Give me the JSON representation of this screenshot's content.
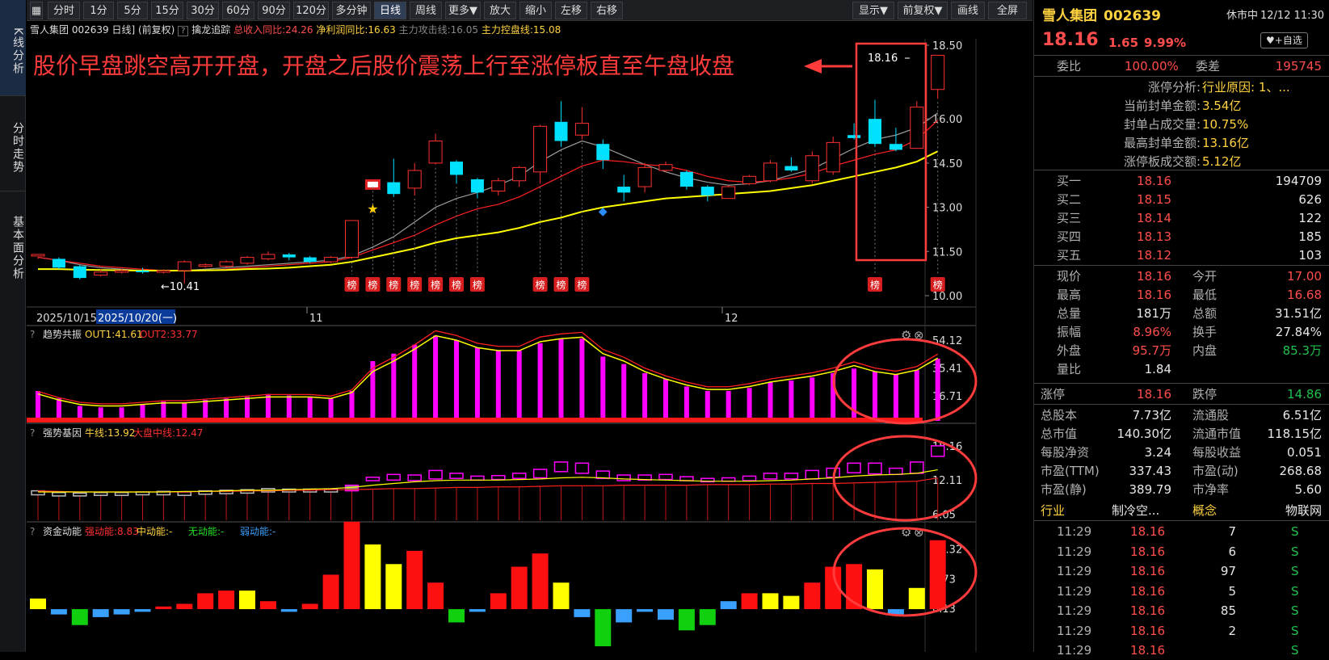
{
  "left_tabs": [
    "K线分析",
    "分时走势",
    "基本面分析"
  ],
  "toolbar": {
    "buttons": [
      "分时",
      "1分",
      "5分",
      "15分",
      "30分",
      "60分",
      "90分",
      "120分",
      "多分钟",
      "日线",
      "周线",
      "更多▼",
      "放大",
      "缩小",
      "左移",
      "右移"
    ],
    "right_buttons": [
      "显示▼",
      "前复权▼",
      "画线",
      "全屏"
    ]
  },
  "chart_header": {
    "symbol": "雪人集团 002639 日线]",
    "adj": "(前复权)",
    "q": "?",
    "indicator": "擒龙追踪",
    "rev": "总收入同比:24.26",
    "profit": "净利润同比:16.63",
    "attack": "主力攻击线:16.05",
    "control": "主力控盘线:15.08"
  },
  "annotation": {
    "text": "股价早盘跳空高开开盘，开盘之后股价震荡上行至涨停板直至午盘收盘",
    "price_label": "18.16"
  },
  "main_axis": [
    "18.50",
    "16.00",
    "14.50",
    "13.00",
    "11.50",
    "10.00"
  ],
  "low_label": "←10.41",
  "bang_label": "榜",
  "dates": {
    "d1": "2025/10/15",
    "d2": "2025/10/20(一)",
    "m11": "11",
    "m12": "12"
  },
  "sub1": {
    "q": "?",
    "name": "趋势共振",
    "out1": "OUT1:41.61",
    "out2": "OUT2:33.77",
    "axis": [
      "54.12",
      "35.41",
      "16.71"
    ]
  },
  "sub2": {
    "q": "?",
    "name": "强势基因",
    "bull": "牛线:13.92",
    "market": "大盘中线:12.47",
    "axis": [
      "18.16",
      "12.11",
      "6.05"
    ]
  },
  "sub3": {
    "q": "?",
    "name": "资金动能",
    "strong": "强动能:8.83",
    "mid": "中动能:-",
    "none": "无动能:-",
    "weak": "弱动能:-",
    "axis": [
      "11.32",
      "5.73",
      "0.13"
    ]
  },
  "chart_data": {
    "type": "candlestick",
    "candles": [
      [
        11.35,
        11.4,
        11.3,
        11.25
      ],
      [
        11.25,
        10.95,
        11.3,
        10.9
      ],
      [
        11.0,
        10.6,
        11.05,
        10.55
      ],
      [
        10.7,
        10.8,
        10.9,
        10.65
      ],
      [
        10.8,
        10.85,
        10.9,
        10.75
      ],
      [
        10.85,
        10.8,
        10.95,
        10.75
      ],
      [
        10.8,
        10.85,
        10.9,
        10.75
      ],
      [
        10.85,
        11.15,
        11.2,
        10.41
      ],
      [
        11.0,
        11.05,
        11.1,
        10.95
      ],
      [
        11.0,
        11.15,
        11.2,
        10.95
      ],
      [
        11.1,
        11.3,
        11.35,
        11.05
      ],
      [
        11.25,
        11.4,
        11.5,
        11.2
      ],
      [
        11.4,
        11.3,
        11.45,
        11.2
      ],
      [
        11.3,
        11.15,
        11.35,
        11.1
      ],
      [
        11.15,
        11.3,
        11.35,
        11.1
      ],
      [
        11.3,
        12.55,
        12.55,
        11.25
      ],
      [
        13.8,
        13.8,
        13.8,
        13.8
      ],
      [
        13.85,
        13.45,
        14.65,
        13.35
      ],
      [
        13.65,
        14.25,
        14.5,
        13.4
      ],
      [
        14.5,
        15.25,
        15.5,
        14.45
      ],
      [
        14.55,
        14.1,
        14.6,
        13.8
      ],
      [
        13.95,
        13.5,
        14.0,
        13.3
      ],
      [
        13.55,
        13.9,
        14.0,
        13.4
      ],
      [
        13.9,
        14.35,
        14.4,
        13.7
      ],
      [
        14.2,
        15.75,
        15.8,
        13.8
      ],
      [
        15.9,
        15.25,
        16.6,
        15.05
      ],
      [
        15.45,
        15.85,
        16.4,
        15.3
      ],
      [
        15.15,
        14.6,
        15.3,
        14.3
      ],
      [
        13.7,
        13.5,
        14.1,
        13.2
      ],
      [
        13.7,
        14.35,
        14.5,
        13.5
      ],
      [
        14.25,
        14.45,
        14.55,
        14.2
      ],
      [
        14.2,
        13.7,
        14.25,
        13.6
      ],
      [
        13.7,
        13.4,
        13.75,
        13.2
      ],
      [
        13.3,
        13.7,
        13.75,
        13.3
      ],
      [
        13.8,
        14.05,
        14.1,
        13.75
      ],
      [
        13.9,
        14.5,
        14.6,
        13.85
      ],
      [
        14.4,
        14.25,
        14.7,
        14.2
      ],
      [
        13.9,
        14.75,
        14.9,
        13.8
      ],
      [
        14.2,
        15.2,
        15.4,
        14.1
      ],
      [
        15.45,
        15.35,
        15.85,
        15.3
      ],
      [
        16.0,
        15.15,
        16.65,
        15.05
      ],
      [
        15.15,
        14.95,
        15.7,
        14.9
      ],
      [
        15.0,
        16.4,
        16.6,
        15.0
      ],
      [
        17.0,
        18.16,
        18.16,
        16.68
      ]
    ],
    "ma_red": [
      11.3,
      11.2,
      11.1,
      11.0,
      10.95,
      10.9,
      10.85,
      10.85,
      10.85,
      10.9,
      10.95,
      11.0,
      11.05,
      11.1,
      11.15,
      11.3,
      11.55,
      11.8,
      12.05,
      12.4,
      12.7,
      12.95,
      13.1,
      13.35,
      13.7,
      14.05,
      14.4,
      14.6,
      14.55,
      14.45,
      14.4,
      14.25,
      14.05,
      13.9,
      13.85,
      13.9,
      14.0,
      14.15,
      14.4,
      14.6,
      14.8,
      14.95,
      15.3,
      15.95
    ],
    "ma_yel": [
      10.9,
      10.9,
      10.88,
      10.87,
      10.86,
      10.85,
      10.85,
      10.85,
      10.86,
      10.87,
      10.9,
      10.92,
      10.95,
      11.0,
      11.05,
      11.15,
      11.3,
      11.45,
      11.6,
      11.8,
      11.95,
      12.05,
      12.15,
      12.3,
      12.5,
      12.65,
      12.85,
      13.0,
      13.1,
      13.2,
      13.3,
      13.35,
      13.4,
      13.45,
      13.5,
      13.55,
      13.65,
      13.75,
      13.9,
      14.05,
      14.2,
      14.35,
      14.55,
      14.9
    ],
    "ma_grey": [
      11.3,
      11.2,
      11.05,
      10.95,
      10.9,
      10.85,
      10.85,
      10.85,
      10.9,
      10.95,
      11.0,
      11.05,
      11.1,
      11.15,
      11.2,
      11.35,
      11.65,
      12.0,
      12.5,
      13.0,
      13.3,
      13.5,
      13.75,
      14.05,
      14.55,
      14.95,
      15.25,
      15.05,
      14.75,
      14.45,
      14.2,
      14.0,
      13.85,
      13.75,
      13.8,
      13.9,
      14.1,
      14.3,
      14.65,
      15.0,
      15.3,
      15.45,
      15.7,
      16.2
    ],
    "bang_idx": [
      15,
      16,
      17,
      18,
      19,
      20,
      21,
      24,
      25,
      26,
      40,
      43
    ],
    "sub1_bars": [
      20,
      15,
      10,
      9,
      9,
      11,
      13,
      12,
      14,
      15,
      16,
      18,
      17,
      16,
      15,
      20,
      40,
      45,
      51,
      57,
      54,
      49,
      47,
      47,
      52,
      55,
      55,
      43,
      38,
      32,
      28,
      23,
      20,
      20,
      22,
      26,
      27,
      29,
      32,
      35,
      33,
      31,
      34,
      41.61
    ],
    "sub1_ma": [
      18,
      14,
      11,
      10,
      10,
      11,
      12,
      12,
      13,
      14,
      15,
      16,
      16,
      16,
      15,
      19,
      33,
      40,
      48,
      57,
      54,
      49,
      47,
      47,
      53,
      55,
      56,
      45,
      40,
      33,
      28,
      24,
      21,
      21,
      23,
      26,
      28,
      30,
      33,
      37,
      33,
      31,
      34,
      42
    ],
    "sub2_boxes": [
      [
        9.5,
        10.2
      ],
      [
        9.3,
        9.9
      ],
      [
        9.3,
        9.8
      ],
      [
        9.4,
        9.9
      ],
      [
        9.4,
        9.9
      ],
      [
        9.5,
        10.0
      ],
      [
        9.5,
        10.1
      ],
      [
        9.4,
        10.0
      ],
      [
        9.6,
        10.2
      ],
      [
        9.7,
        10.3
      ],
      [
        9.8,
        10.4
      ],
      [
        10.0,
        10.6
      ],
      [
        10.0,
        10.5
      ],
      [
        10.0,
        10.5
      ],
      [
        10.0,
        10.5
      ],
      [
        10.2,
        11.2
      ],
      [
        12.0,
        12.6
      ],
      [
        12.1,
        13.1
      ],
      [
        12.0,
        13.0
      ],
      [
        12.3,
        13.8
      ],
      [
        12.4,
        13.3
      ],
      [
        12.1,
        12.8
      ],
      [
        12.2,
        12.9
      ],
      [
        12.4,
        13.3
      ],
      [
        12.5,
        14.0
      ],
      [
        13.6,
        15.3
      ],
      [
        13.3,
        15.1
      ],
      [
        12.4,
        13.7
      ],
      [
        12.0,
        13.0
      ],
      [
        12.1,
        13.0
      ],
      [
        12.2,
        13.1
      ],
      [
        12.0,
        12.7
      ],
      [
        11.8,
        12.4
      ],
      [
        11.9,
        12.5
      ],
      [
        12.0,
        12.8
      ],
      [
        12.3,
        13.3
      ],
      [
        12.3,
        13.3
      ],
      [
        12.3,
        13.8
      ],
      [
        12.6,
        14.2
      ],
      [
        13.4,
        15.1
      ],
      [
        13.2,
        15.1
      ],
      [
        13.1,
        14.2
      ],
      [
        13.3,
        15.3
      ],
      [
        16.3,
        18.16
      ]
    ],
    "sub2_red": [
      10.2,
      10.1,
      10.0,
      10.0,
      10.0,
      10.0,
      10.0,
      10.0,
      10.1,
      10.1,
      10.2,
      10.2,
      10.3,
      10.3,
      10.4,
      10.4,
      10.5,
      10.6,
      10.6,
      10.7,
      10.8,
      10.8,
      10.9,
      10.9,
      11.0,
      11.1,
      11.1,
      11.1,
      11.2,
      11.2,
      11.2,
      11.2,
      11.3,
      11.3,
      11.3,
      11.4,
      11.4,
      11.5,
      11.5,
      11.6,
      11.7,
      11.8,
      11.9,
      12.47
    ],
    "sub2_yel": [
      10.0,
      10.0,
      10.0,
      10.0,
      10.0,
      10.0,
      10.0,
      10.1,
      10.1,
      10.2,
      10.3,
      10.3,
      10.4,
      10.5,
      10.6,
      10.8,
      11.2,
      11.5,
      11.8,
      12.0,
      12.1,
      12.1,
      12.1,
      12.2,
      12.3,
      12.5,
      12.6,
      12.5,
      12.3,
      12.2,
      12.1,
      12.0,
      11.9,
      11.9,
      11.9,
      12.0,
      12.1,
      12.3,
      12.5,
      12.8,
      13.0,
      13.1,
      13.3,
      13.92
    ],
    "sub3_bars": [
      2,
      -1,
      -3,
      -1.5,
      -1,
      -0.5,
      0.5,
      1,
      3,
      3.5,
      3.5,
      1.5,
      -0.5,
      1,
      6.5,
      16.5,
      12.2,
      8.5,
      11,
      5,
      -2.5,
      -0.5,
      3,
      8,
      10.5,
      5,
      -1.5,
      -7,
      -2.5,
      -0.5,
      -2,
      -4,
      -3,
      1.5,
      3,
      3,
      2.5,
      5,
      8,
      8.5,
      7.5,
      -1,
      4,
      13
    ]
  },
  "stock": {
    "name": "雪人集团",
    "code": "002639",
    "status": "休市中",
    "time": "12/12 11:30",
    "price": "18.16",
    "chg": "1.65",
    "pct": "9.99%",
    "fav": "♥+自选"
  },
  "weibi": {
    "l1": "委比",
    "v1": "100.00%",
    "l2": "委差",
    "v2": "195745"
  },
  "limit": [
    {
      "l": "涨停分析:",
      "v": "行业原因: 1、..."
    },
    {
      "l": "当前封单金额:",
      "v": "3.54亿"
    },
    {
      "l": "封单占成交量:",
      "v": "10.75%"
    },
    {
      "l": "最高封单金额:",
      "v": "13.16亿"
    },
    {
      "l": "涨停板成交额:",
      "v": "5.12亿"
    }
  ],
  "bids": [
    {
      "l": "买一",
      "p": "18.16",
      "v": "194709"
    },
    {
      "l": "买二",
      "p": "18.15",
      "v": "626"
    },
    {
      "l": "买三",
      "p": "18.14",
      "v": "122"
    },
    {
      "l": "买四",
      "p": "18.13",
      "v": "185"
    },
    {
      "l": "买五",
      "p": "18.12",
      "v": "103"
    }
  ],
  "quote": [
    {
      "l1": "现价",
      "v1": "18.16",
      "c1": "red",
      "l2": "今开",
      "v2": "17.00",
      "c2": "red"
    },
    {
      "l1": "最高",
      "v1": "18.16",
      "c1": "red",
      "l2": "最低",
      "v2": "16.68",
      "c2": "red"
    },
    {
      "l1": "总量",
      "v1": "181万",
      "c1": "wht",
      "l2": "总额",
      "v2": "31.51亿",
      "c2": "wht"
    },
    {
      "l1": "振幅",
      "v1": "8.96%",
      "c1": "red",
      "l2": "换手",
      "v2": "27.84%",
      "c2": "wht"
    },
    {
      "l1": "外盘",
      "v1": "95.7万",
      "c1": "red",
      "l2": "内盘",
      "v2": "85.3万",
      "c2": "grn"
    },
    {
      "l1": "量比",
      "v1": "1.84",
      "c1": "wht",
      "l2": "",
      "v2": "",
      "c2": "wht"
    }
  ],
  "limits2": {
    "l1": "涨停",
    "v1": "18.16",
    "l2": "跌停",
    "v2": "14.86"
  },
  "fund": [
    {
      "l1": "总股本",
      "v1": "7.73亿",
      "l2": "流通股",
      "v2": "6.51亿"
    },
    {
      "l1": "总市值",
      "v1": "140.30亿",
      "l2": "流通市值",
      "v2": "118.15亿"
    },
    {
      "l1": "每股净资",
      "v1": "3.24",
      "l2": "每股收益",
      "v2": "0.051"
    },
    {
      "l1": "市盈(TTM)",
      "v1": "337.43",
      "l2": "市盈(动)",
      "v2": "268.68"
    },
    {
      "l1": "市盈(静)",
      "v1": "389.79",
      "l2": "市净率",
      "v2": "5.60"
    }
  ],
  "industry": {
    "l1": "行业",
    "v1": "制冷空...",
    "l2": "概念",
    "v2": "物联网"
  },
  "ticks": [
    {
      "t": "11:29",
      "p": "18.16",
      "v": "7",
      "s": "S"
    },
    {
      "t": "11:29",
      "p": "18.16",
      "v": "6",
      "s": "S"
    },
    {
      "t": "11:29",
      "p": "18.16",
      "v": "97",
      "s": "S"
    },
    {
      "t": "11:29",
      "p": "18.16",
      "v": "5",
      "s": "S"
    },
    {
      "t": "11:29",
      "p": "18.16",
      "v": "85",
      "s": "S"
    },
    {
      "t": "11:29",
      "p": "18.16",
      "v": "2",
      "s": "S"
    },
    {
      "t": "11:29",
      "p": "18.16",
      "v": "",
      "s": "S"
    }
  ],
  "colors": {
    "up": "#ff3030",
    "down": "#00e0ff",
    "yellow": "#ffff00",
    "magenta": "#ff00ff"
  }
}
